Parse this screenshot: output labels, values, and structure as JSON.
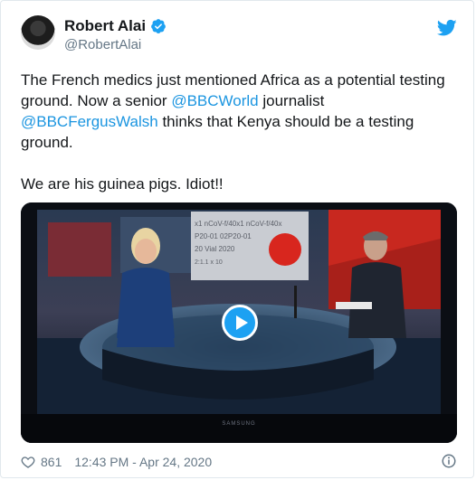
{
  "author": {
    "display_name": "Robert Alai",
    "handle": "@RobertAlai"
  },
  "tweet": {
    "part1": "The French medics just mentioned Africa as a potential testing ground. Now a senior ",
    "mention1": "@BBCWorld",
    "part2": " journalist ",
    "mention2": "@BBCFergusWalsh",
    "part3": " thinks that Kenya should be a testing ground.\n\nWe are his guinea pigs. Idiot!!"
  },
  "media": {
    "tv_brand": "SAMSUNG",
    "screen_text": {
      "line1": "x1 nCoV-f/40x1 nCoV-f/40x",
      "line2": "P20-01    02P20-01",
      "line3": "20   Vial  2020",
      "line4": "2:1.1  x 10"
    }
  },
  "footer": {
    "likes": "861",
    "timestamp": "12:43 PM - Apr 24, 2020"
  },
  "colors": {
    "link": "#1b95e0",
    "twitter_blue": "#1da1f2",
    "secondary_text": "#657786"
  }
}
